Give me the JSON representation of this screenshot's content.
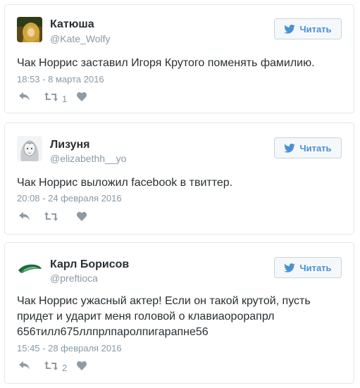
{
  "tweets": [
    {
      "name": "Катюша",
      "handle": "@Kate_Wolfy",
      "follow_label": "Читать",
      "text": "Чак Норрис заставил Игоря Крутого поменять фамилию.",
      "timestamp": "18:53 - 8 марта 2016",
      "retweet_count": "1",
      "avatar": "avatar-photo-blonde"
    },
    {
      "name": "Лизуня",
      "handle": "@elizabethh__yo",
      "follow_label": "Читать",
      "text": "Чак Норрис выложил facebook в твиттер.",
      "timestamp": "20:08 - 24 февраля 2016",
      "retweet_count": "",
      "avatar": "avatar-sketch-girl"
    },
    {
      "name": "Карл Борисов",
      "handle": "@preftioca",
      "follow_label": "Читать",
      "text": "Чак Норрис ужасный актер! Если он такой крутой, пусть придет и ударит меня головой о клавиаорорапрл 656тилл675ллпрлпаролпигарапне56",
      "timestamp": "15:45 - 28 февраля 2016",
      "retweet_count": "2",
      "avatar": "avatar-green-blade"
    }
  ],
  "colors": {
    "twitter_blue": "#4a90d6",
    "name_text": "#292f33",
    "muted_text": "#8899a6",
    "icon_gray": "#aab8c2",
    "card_border": "#e1e8ed"
  },
  "icons": {
    "follow": "twitter-bird-icon",
    "reply": "reply-icon",
    "retweet": "retweet-icon",
    "like": "heart-icon"
  }
}
